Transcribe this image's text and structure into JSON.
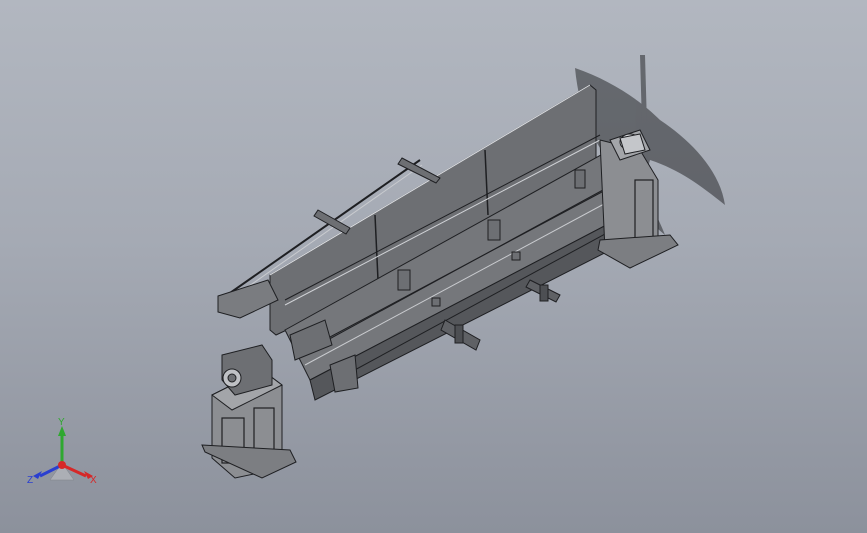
{
  "viewport": {
    "background_top": "#b2b7c0",
    "background_bottom": "#8c919c",
    "model_color": "#6e7074",
    "edge_color": "#1e1f22"
  },
  "triad": {
    "y_label": "Y",
    "x_label": "X",
    "z_label": "Z",
    "y_color": "#2fa830",
    "x_color": "#d62828",
    "z_color": "#2a3fd0"
  }
}
